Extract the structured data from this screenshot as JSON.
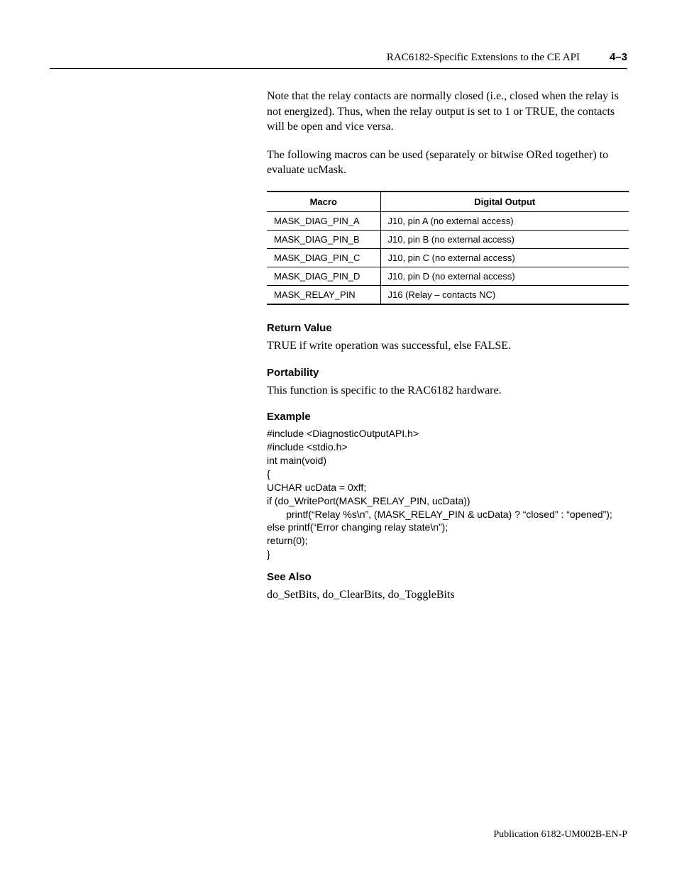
{
  "header": {
    "title": "RAC6182-Specific Extensions to the CE API",
    "pageno": "4–3"
  },
  "paragraphs": {
    "p1": "Note that the relay contacts are normally closed (i.e., closed when the relay is not energized).  Thus, when the relay output is set to 1 or TRUE, the contacts will be open and vice versa.",
    "p2": "The following macros can be used (separately or bitwise ORed together) to evaluate ucMask."
  },
  "table": {
    "headers": {
      "c0": "Macro",
      "c1": "Digital Output"
    },
    "rows": [
      {
        "c0": "MASK_DIAG_PIN_A",
        "c1": "J10, pin A (no external access)"
      },
      {
        "c0": "MASK_DIAG_PIN_B",
        "c1": "J10, pin B (no external access)"
      },
      {
        "c0": "MASK_DIAG_PIN_C",
        "c1": "J10, pin C (no external access)"
      },
      {
        "c0": "MASK_DIAG_PIN_D",
        "c1": "J10, pin D (no external access)"
      },
      {
        "c0": "MASK_RELAY_PIN",
        "c1": "J16 (Relay – contacts NC)"
      }
    ]
  },
  "sections": {
    "return_value": {
      "title": "Return Value",
      "body": "TRUE if write operation was successful, else FALSE."
    },
    "portability": {
      "title": "Portability",
      "body": "This function is specific to the RAC6182 hardware."
    },
    "example": {
      "title": "Example"
    },
    "see_also": {
      "title": "See Also",
      "body": "do_SetBits, do_ClearBits, do_ToggleBits"
    }
  },
  "code": {
    "l0": "#include <DiagnosticOutputAPI.h>",
    "l1": "#include <stdio.h>",
    "l2": "",
    "l3": "int main(void)",
    "l4": "{",
    "l5": "UCHAR ucData = 0xff;",
    "l6": "",
    "l7": "if (do_WritePort(MASK_RELAY_PIN, ucData))",
    "l8": "       printf(“Relay %s\\n”, (MASK_RELAY_PIN & ucData) ? “closed” : “opened”);",
    "l9": "else printf(“Error changing relay state\\n”);",
    "l10": "",
    "l11": "return(0);",
    "l12": "}"
  },
  "footer": "Publication 6182-UM002B-EN-P"
}
